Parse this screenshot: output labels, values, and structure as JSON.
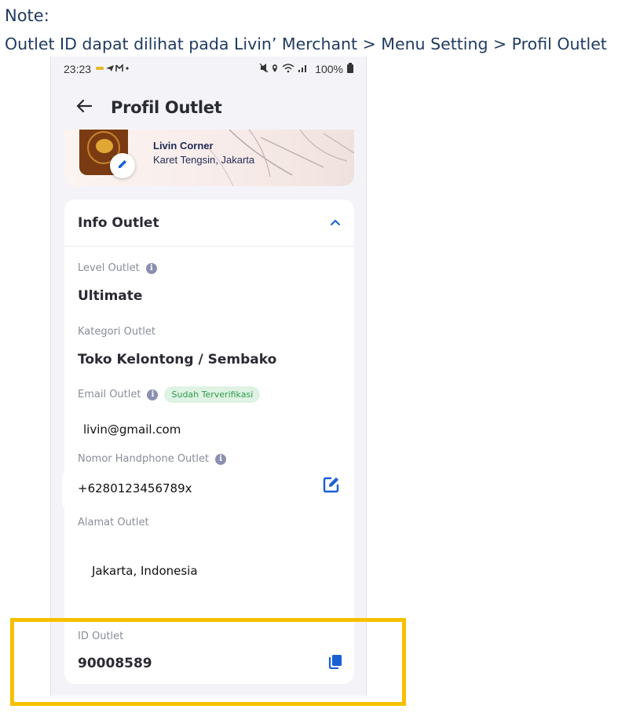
{
  "note": {
    "line1": "Note:",
    "line2": "Outlet ID dapat dilihat pada Livin’ Merchant > Menu Setting > Profil Outlet"
  },
  "status_bar": {
    "time": "23:23",
    "battery": "100%"
  },
  "header": {
    "title": "Profil Outlet"
  },
  "outlet": {
    "name": "Livin Corner",
    "location": "Karet Tengsin, Jakarta"
  },
  "info_outlet": {
    "title": "Info Outlet",
    "level_label": "Level Outlet",
    "level_value": "Ultimate",
    "category_label": "Kategori Outlet",
    "category_value": "Toko Kelontong / Sembako",
    "email_label": "Email Outlet",
    "email_badge": "Sudah Terverifikasi",
    "email_value": "livin@gmail.com",
    "phone_label": "Nomor Handphone Outlet",
    "phone_value": "+6280123456789x",
    "address_label": "Alamat Outlet",
    "address_value": "Jakarta, Indonesia",
    "id_label": "ID Outlet",
    "id_value": "90008589"
  },
  "colors": {
    "highlight": "#f6c000",
    "accent": "#1b5fd6",
    "badge_text": "#2f9a4b",
    "note_text": "#1f3a5f"
  },
  "icons": [
    "back-arrow-icon",
    "pencil-icon",
    "chevron-up-icon",
    "info-icon",
    "edit-square-icon",
    "copy-icon"
  ]
}
